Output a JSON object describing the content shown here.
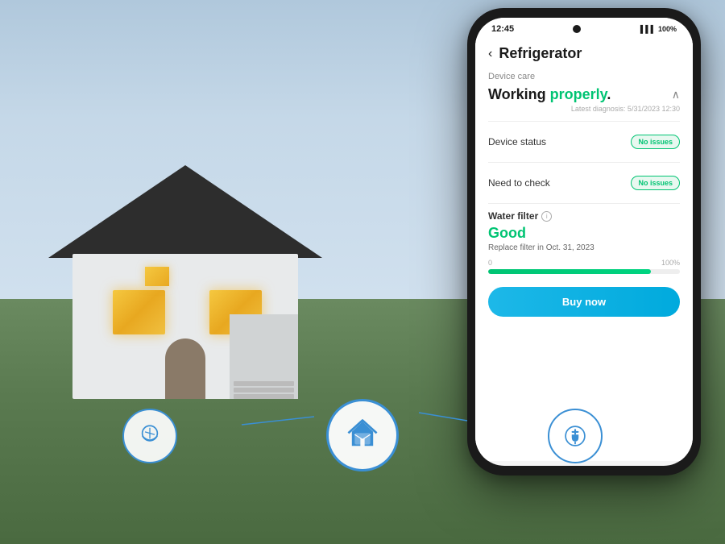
{
  "background": {
    "color_sky": "#b0c8dc",
    "color_ground": "#5a7a50"
  },
  "phone": {
    "status_bar": {
      "time": "12:45",
      "battery": "100%",
      "signal": "||||"
    },
    "header": {
      "back_label": "‹",
      "title": "Refrigerator"
    },
    "device_care": {
      "section_label": "Device care",
      "working_text": "Working ",
      "properly_text": "properly",
      "period": ".",
      "diagnosis_label": "Latest diagnosis: 5/31/2023 12:30",
      "device_status_label": "Device status",
      "device_status_badge": "No issues",
      "need_to_check_label": "Need to check",
      "need_to_check_badge": "No issues"
    },
    "water_filter": {
      "section_label": "Water filter",
      "status": "Good",
      "replace_label": "Replace filter in Oct. 31, 2023",
      "progress_start": "0",
      "progress_end": "100%",
      "progress_value": 85,
      "buy_button_label": "Buy now"
    }
  },
  "icons": {
    "left_icon": "bowl",
    "center_icon": "house",
    "right_icon": "plug"
  }
}
